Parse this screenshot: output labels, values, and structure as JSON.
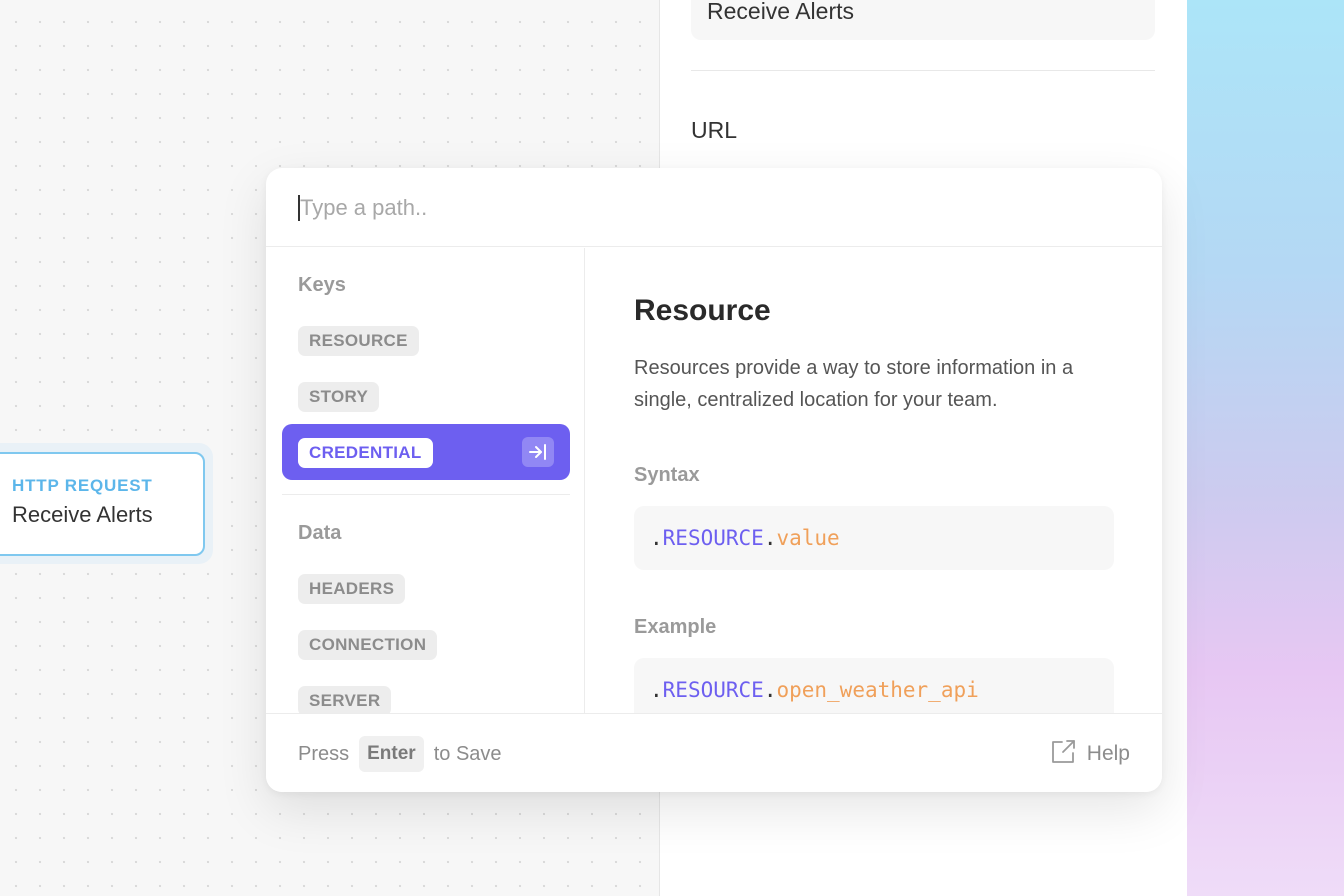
{
  "side_panel": {
    "name_value": "Receive Alerts",
    "url_label": "URL"
  },
  "canvas_node": {
    "type_label": "HTTP REQUEST",
    "title": "Receive Alerts"
  },
  "path_picker": {
    "input": {
      "value": "",
      "placeholder": "Type a path.."
    },
    "groups": [
      {
        "label": "Keys",
        "items": [
          "RESOURCE",
          "STORY",
          "CREDENTIAL"
        ]
      },
      {
        "label": "Data",
        "items": [
          "HEADERS",
          "CONNECTION",
          "SERVER"
        ]
      }
    ],
    "selected_item": "CREDENTIAL",
    "detail": {
      "title": "Resource",
      "description": "Resources provide a way to store information in a single, centralized location for your team.",
      "syntax_label": "Syntax",
      "syntax": {
        "dot1": ".",
        "key": "RESOURCE",
        "dot2": ".",
        "val": "value"
      },
      "example_label": "Example",
      "example": {
        "dot1": ".",
        "key": "RESOURCE",
        "dot2": ".",
        "val": "open_weather_api"
      }
    },
    "footer": {
      "hint_prefix": "Press",
      "hint_key": "Enter",
      "hint_suffix": "to Save",
      "help_label": "Help"
    }
  },
  "colors": {
    "accent": "#6d5ff0",
    "node_accent": "#5cb6ea",
    "code_value": "#f0a05a"
  },
  "icons": [
    "insert-path-icon",
    "external-link-icon"
  ]
}
